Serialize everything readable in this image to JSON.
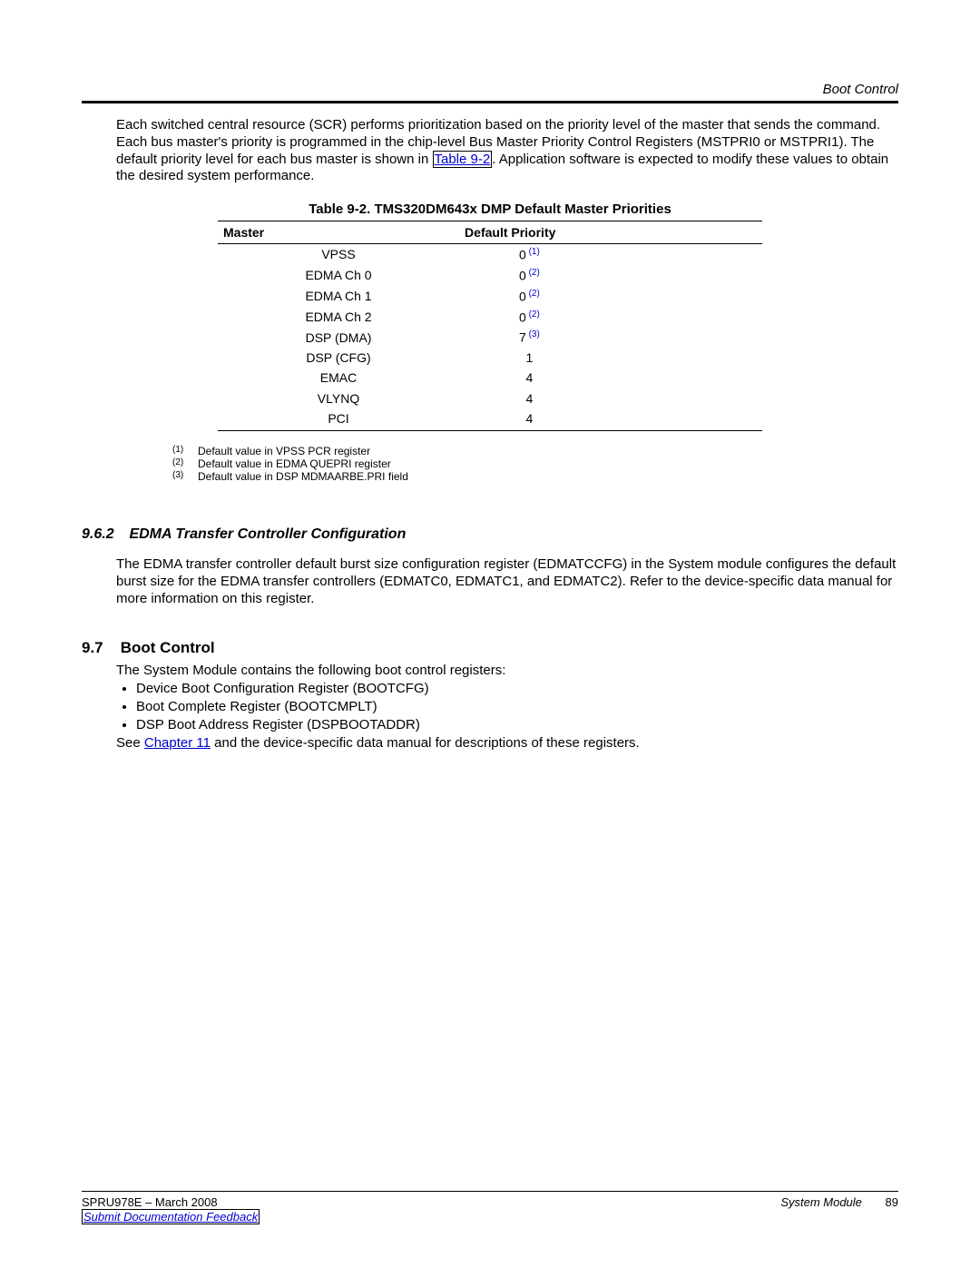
{
  "header": {
    "right": "Boot Control"
  },
  "intro": {
    "pre": "Each switched central resource (SCR) performs prioritization based on the priority level of the master that sends the command. Each bus master's priority is programmed in the chip-level Bus Master Priority Control Registers (MSTPRI0 or MSTPRI1). The default priority level for each bus master is shown in ",
    "link": "Table 9-2",
    "post": ". Application software is expected to modify these values to obtain the desired system performance."
  },
  "table": {
    "title": "Table 9-2. TMS320DM643x DMP Default Master Priorities",
    "headers": {
      "master": "Master",
      "priority": "Default Priority"
    },
    "rows": [
      {
        "master": "VPSS",
        "priority": "0",
        "note": "(1)"
      },
      {
        "master": "EDMA Ch 0",
        "priority": "0",
        "note": "(2)"
      },
      {
        "master": "EDMA Ch 1",
        "priority": "0",
        "note": "(2)"
      },
      {
        "master": "EDMA Ch 2",
        "priority": "0",
        "note": "(2)"
      },
      {
        "master": "DSP (DMA)",
        "priority": "7",
        "note": "(3)"
      },
      {
        "master": "DSP (CFG)",
        "priority": "1",
        "note": ""
      },
      {
        "master": "EMAC",
        "priority": "4",
        "note": ""
      },
      {
        "master": "VLYNQ",
        "priority": "4",
        "note": ""
      },
      {
        "master": "PCI",
        "priority": "4",
        "note": ""
      }
    ],
    "footnotes": [
      {
        "num": "(1)",
        "text": "Default value in VPSS PCR register"
      },
      {
        "num": "(2)",
        "text": "Default value in EDMA QUEPRI register"
      },
      {
        "num": "(3)",
        "text": "Default value in DSP MDMAARBE.PRI field"
      }
    ]
  },
  "s962": {
    "num": "9.6.2",
    "title": "EDMA Transfer Controller Configuration",
    "body": "The EDMA transfer controller default burst size configuration register (EDMATCCFG) in the System module configures the default burst size for the EDMA transfer controllers (EDMATC0, EDMATC1, and EDMATC2). Refer to the device-specific data manual for more information on this register."
  },
  "s97": {
    "num": "9.7",
    "title": "Boot Control",
    "lead": "The System Module contains the following boot control registers:",
    "bullets": [
      "Device Boot Configuration Register (BOOTCFG)",
      "Boot Complete Register (BOOTCMPLT)",
      "DSP Boot Address Register (DSPBOOTADDR)"
    ],
    "trail_pre": "See ",
    "trail_link": "Chapter 11",
    "trail_post": " and the device-specific data manual for descriptions of these registers."
  },
  "footer": {
    "doc": "SPRU978E – March 2008",
    "feedback": "Submit Documentation Feedback",
    "module": "System Module",
    "page": "89"
  }
}
